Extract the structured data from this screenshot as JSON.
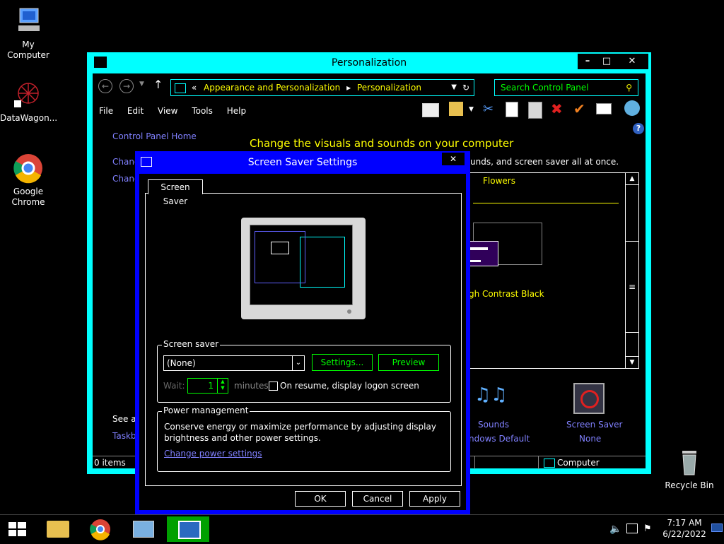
{
  "desktop": {
    "icons": [
      {
        "label": "My Computer"
      },
      {
        "label": "DataWagon..."
      },
      {
        "label": "Google\nChrome"
      },
      {
        "label": "Recycle Bin"
      }
    ]
  },
  "window": {
    "title": "Personalization",
    "controls": {
      "minimize": "–",
      "maximize": "□",
      "close": "✕"
    },
    "address": {
      "prefix": "«",
      "crumb1": "Appearance and Personalization",
      "sep": "▸",
      "crumb2": "Personalization"
    },
    "search_placeholder": "Search Control Panel",
    "menu": [
      "File",
      "Edit",
      "View",
      "Tools",
      "Help"
    ],
    "sidebar": {
      "home": "Control Panel Home",
      "link1": "Chang",
      "link2": "Chang",
      "see_also": "See al",
      "taskbar": "Taskb"
    },
    "heading": "Change the visuals and sounds on your computer",
    "subheading": "unds, and screen saver all at once.",
    "theme_group": "Flowers",
    "theme_name": "gh Contrast Black",
    "bottom": {
      "sounds_label": "Sounds",
      "sounds_value": "ndows Default",
      "screensaver_label": "Screen Saver",
      "screensaver_value": "None"
    },
    "status": {
      "items": "0 items",
      "computer": "Computer"
    }
  },
  "dialog": {
    "title": "Screen Saver Settings",
    "close": "✕",
    "tab": "Screen Saver",
    "screen_saver_group": "Screen saver",
    "selected": "(None)",
    "settings_btn": "Settings...",
    "preview_btn": "Preview",
    "wait_label": "Wait:",
    "wait_value": "1",
    "minutes_label": "minutes",
    "resume_label": "On resume, display logon screen",
    "power_group": "Power management",
    "power_text1": "Conserve energy or maximize performance by adjusting display",
    "power_text2": "brightness and other power settings.",
    "power_link": "Change power settings",
    "ok": "OK",
    "cancel": "Cancel",
    "apply": "Apply"
  },
  "taskbar": {
    "time": "7:17 AM",
    "date": "6/22/2022"
  }
}
